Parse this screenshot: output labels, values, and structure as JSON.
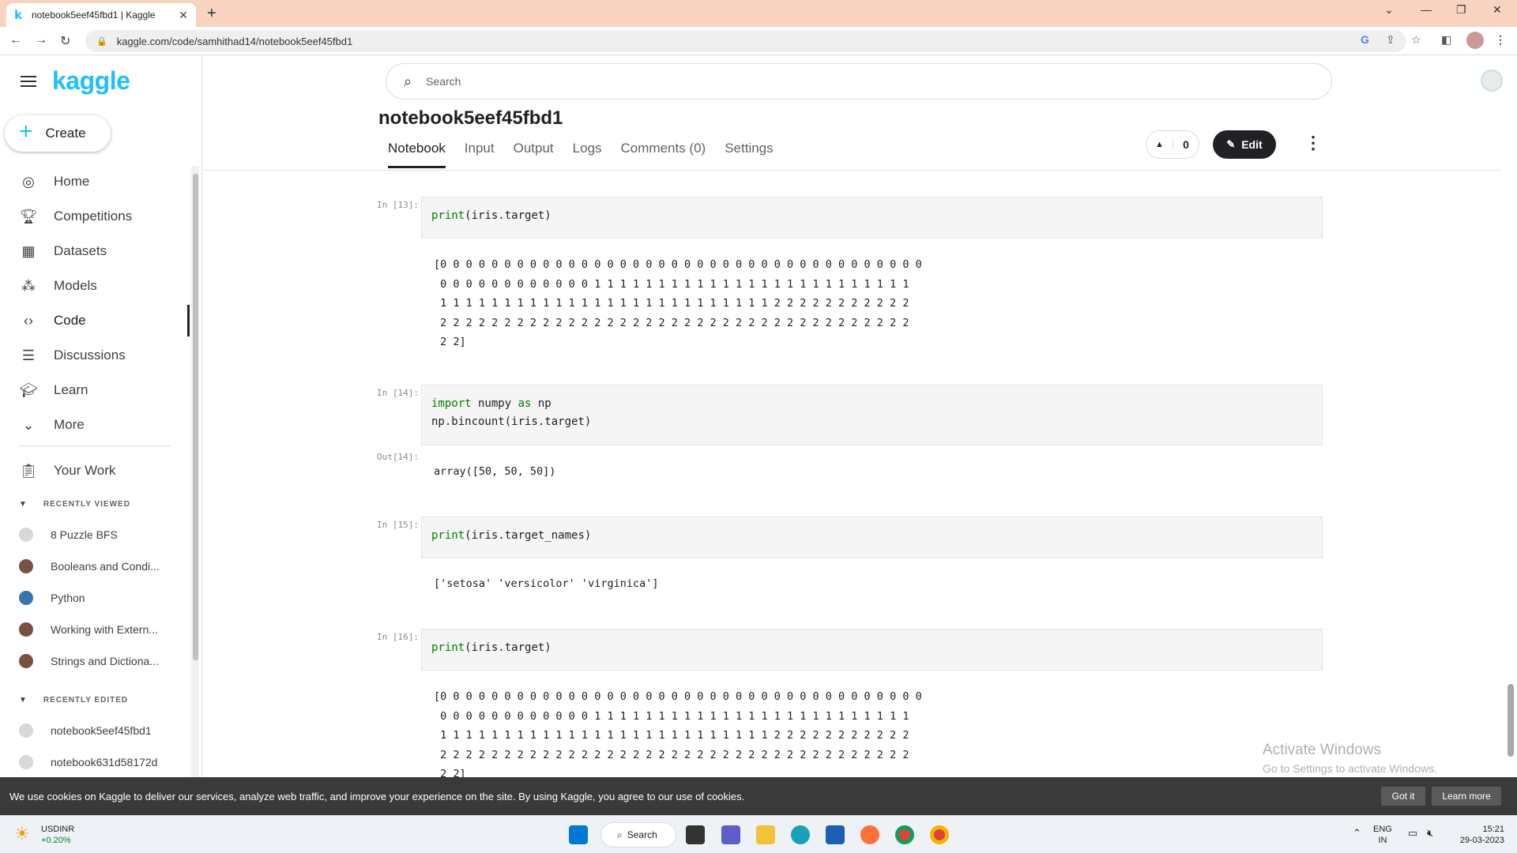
{
  "browser": {
    "tab_title": "notebook5eef45fbd1 | Kaggle",
    "tab_icon": "k",
    "url": "kaggle.com/code/samhithad14/notebook5eef45fbd1"
  },
  "sidebar": {
    "logo": "kaggle",
    "create_label": "Create",
    "items": [
      {
        "label": "Home",
        "icon": "compass-icon"
      },
      {
        "label": "Competitions",
        "icon": "trophy-icon"
      },
      {
        "label": "Datasets",
        "icon": "table-icon"
      },
      {
        "label": "Models",
        "icon": "models-icon"
      },
      {
        "label": "Code",
        "icon": "code-icon"
      },
      {
        "label": "Discussions",
        "icon": "discussion-icon"
      },
      {
        "label": "Learn",
        "icon": "school-icon"
      },
      {
        "label": "More",
        "icon": "chevron-down-icon"
      }
    ],
    "your_work": "Your Work",
    "recently_viewed_header": "RECENTLY VIEWED",
    "recently_viewed": [
      "8 Puzzle BFS",
      "Booleans and Condi...",
      "Python",
      "Working with Extern...",
      "Strings and Dictiona..."
    ],
    "recently_edited_header": "RECENTLY EDITED",
    "recently_edited": [
      "notebook5eef45fbd1",
      "notebook631d58172d"
    ]
  },
  "header": {
    "search_placeholder": "Search",
    "notebook_title": "notebook5eef45fbd1",
    "tabs": [
      "Notebook",
      "Input",
      "Output",
      "Logs",
      "Comments (0)",
      "Settings"
    ],
    "active_tab": "Notebook",
    "vote_count": "0",
    "edit_label": "Edit"
  },
  "cells": {
    "c13": {
      "prompt": "In [13]:",
      "code_fn": "print",
      "code_rest": "(iris.target)",
      "output": "[0 0 0 0 0 0 0 0 0 0 0 0 0 0 0 0 0 0 0 0 0 0 0 0 0 0 0 0 0 0 0 0 0 0 0 0 0 0\n 0 0 0 0 0 0 0 0 0 0 0 0 1 1 1 1 1 1 1 1 1 1 1 1 1 1 1 1 1 1 1 1 1 1 1 1 1\n 1 1 1 1 1 1 1 1 1 1 1 1 1 1 1 1 1 1 1 1 1 1 1 1 1 1 2 2 2 2 2 2 2 2 2 2 2\n 2 2 2 2 2 2 2 2 2 2 2 2 2 2 2 2 2 2 2 2 2 2 2 2 2 2 2 2 2 2 2 2 2 2 2 2 2\n 2 2]"
    },
    "c14": {
      "prompt": "In [14]:",
      "line1_kw1": "import",
      "line1_mid": " numpy ",
      "line1_kw2": "as",
      "line1_end": " np",
      "line2": "np.bincount(iris.target)",
      "out_prompt": "Out[14]:",
      "output": "array([50, 50, 50])"
    },
    "c15": {
      "prompt": "In [15]:",
      "code_fn": "print",
      "code_rest": "(iris.target_names)",
      "output": "['setosa' 'versicolor' 'virginica']"
    },
    "c16": {
      "prompt": "In [16]:",
      "code_fn": "print",
      "code_rest": "(iris.target)",
      "output": "[0 0 0 0 0 0 0 0 0 0 0 0 0 0 0 0 0 0 0 0 0 0 0 0 0 0 0 0 0 0 0 0 0 0 0 0 0 0\n 0 0 0 0 0 0 0 0 0 0 0 0 1 1 1 1 1 1 1 1 1 1 1 1 1 1 1 1 1 1 1 1 1 1 1 1 1\n 1 1 1 1 1 1 1 1 1 1 1 1 1 1 1 1 1 1 1 1 1 1 1 1 1 1 2 2 2 2 2 2 2 2 2 2 2\n 2 2 2 2 2 2 2 2 2 2 2 2 2 2 2 2 2 2 2 2 2 2 2 2 2 2 2 2 2 2 2 2 2 2 2 2 2\n 2 2]"
    }
  },
  "watermark": {
    "title": "Activate Windows",
    "subtitle": "Go to Settings to activate Windows."
  },
  "cookie": {
    "text": "We use cookies on Kaggle to deliver our services, analyze web traffic, and improve your experience on the site. By using Kaggle, you agree to our use of cookies.",
    "got_it": "Got it",
    "learn_more": "Learn more"
  },
  "taskbar": {
    "ticker_name": "USDINR",
    "ticker_change": "+0.20%",
    "search_label": "Search",
    "lang_top": "ENG",
    "lang_bottom": "IN",
    "time": "15:21",
    "date": "29-03-2023"
  },
  "colors": {
    "brand": "#20beff",
    "dark": "#202124",
    "keyword": "#008000",
    "cookie_bg": "#3a3a3a"
  }
}
